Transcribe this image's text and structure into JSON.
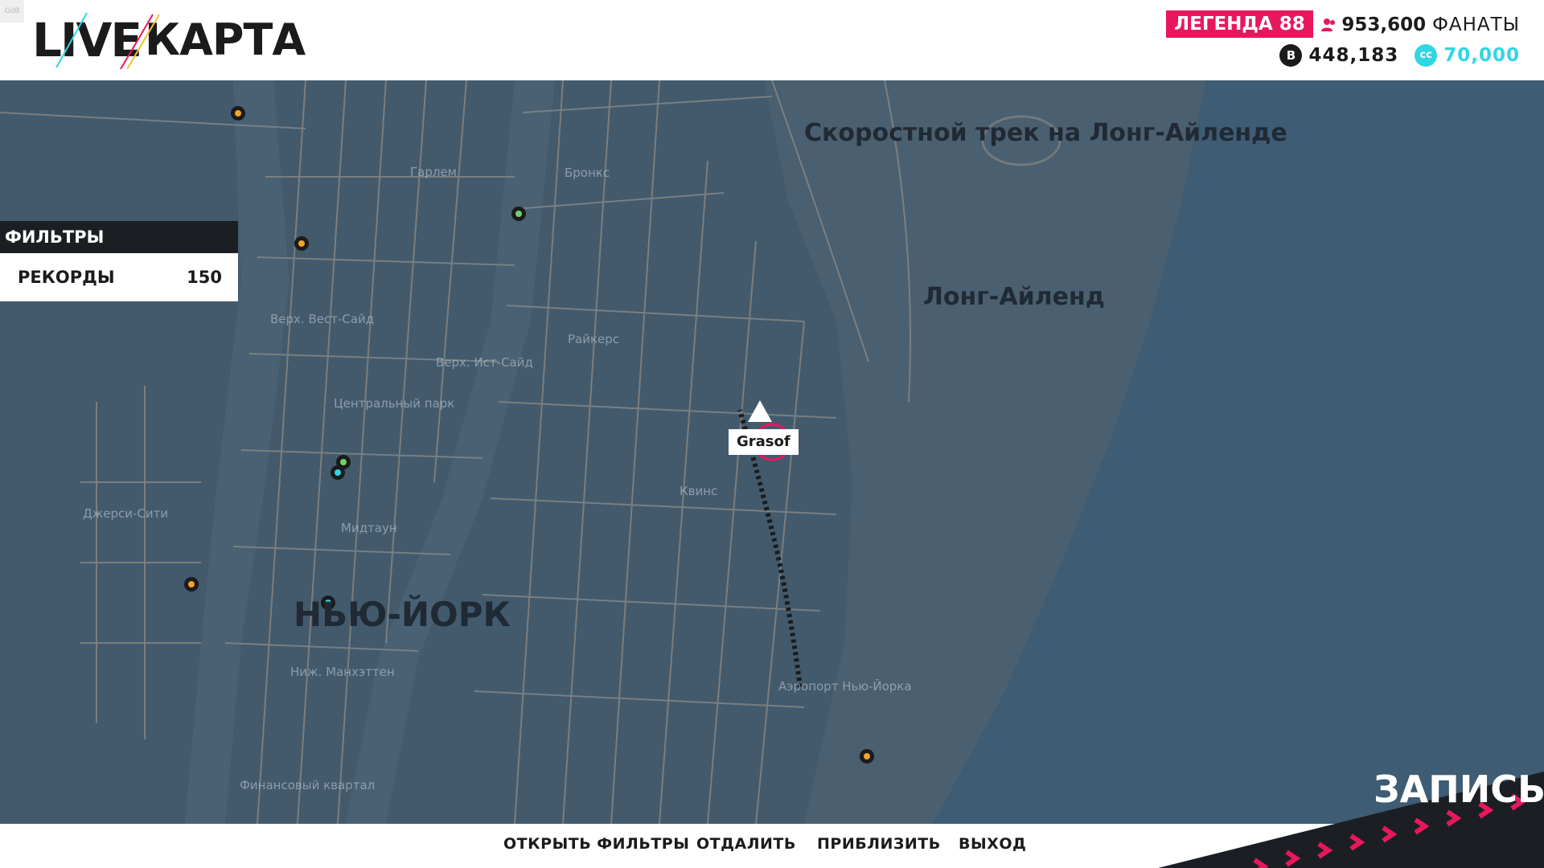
{
  "corner_tag": "GdB",
  "logo": {
    "part1": "LIVE",
    "part2": "КАРТА"
  },
  "header": {
    "legend_badge": "ЛЕГЕНДА 88",
    "fans_value": "953,600",
    "fans_label": "ФАНАТЫ",
    "credits": "448,183",
    "cc_value": "70,000"
  },
  "colors": {
    "accent": "#e8175d",
    "cc": "#2fd6e3",
    "map_bg": "#41566a",
    "roads": "#8c8a86"
  },
  "filters": {
    "title": "ФИЛЬТРЫ",
    "items": [
      {
        "label": "РЕКОРДЫ",
        "count": "150"
      }
    ]
  },
  "map": {
    "regions": {
      "new_york": "НЬЮ-ЙОРК",
      "long_island": "Лонг-Айленд",
      "raceway": "Скоростной трек на Лонг-Айленде"
    },
    "places": {
      "harlem": "Гарлем",
      "bronx": "Бронкс",
      "upper_west": "Верх. Вест-Сайд",
      "upper_east": "Верх. Ист-Сайд",
      "rikers": "Райкерс",
      "central_park": "Центральный парк",
      "queens": "Квинс",
      "jersey_city": "Джерси-Сити",
      "midtown": "Мидтаун",
      "lower_manhattan": "Ниж. Манхэттен",
      "airport": "Аэропорт Нью-Йорка",
      "financial": "Финансовый квартал"
    },
    "player_name": "Grasof"
  },
  "actions": {
    "open_filters": "ОТКРЫТЬ ФИЛЬТРЫ",
    "zoom_out": "ОТДАЛИТЬ",
    "zoom_in": "ПРИБЛИЗИТЬ",
    "exit": "ВЫХОД"
  },
  "record_label": "ЗАПИСЬ",
  "icons": [
    "users-icon",
    "credits-icon",
    "cc-icon",
    "event-marker-icon",
    "player-arrow-icon",
    "target-ring-icon"
  ]
}
